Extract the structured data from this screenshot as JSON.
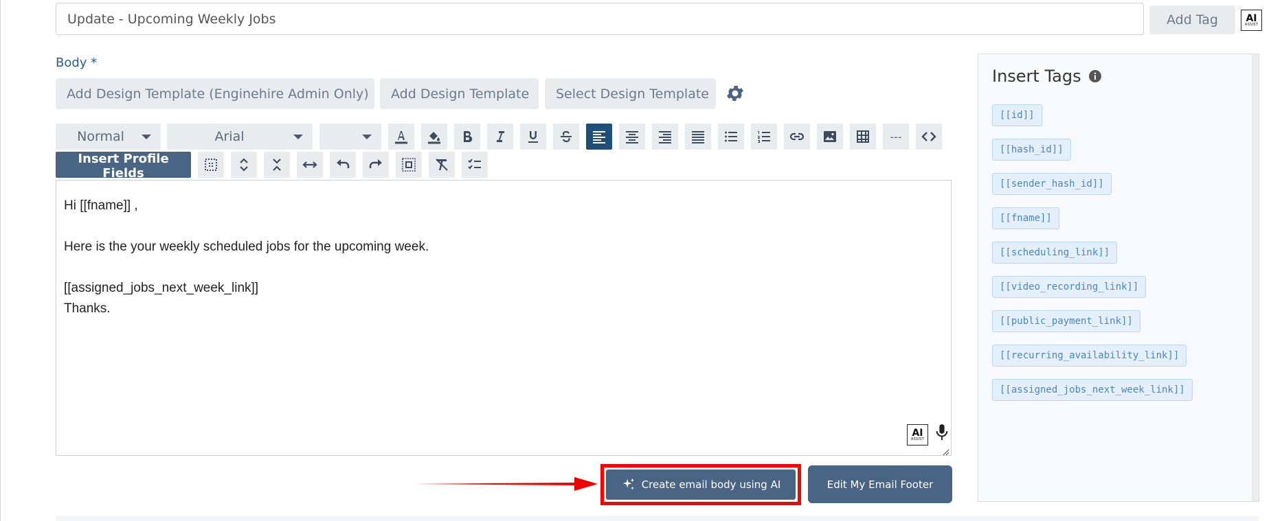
{
  "subject": {
    "value": "Update - Upcoming Weekly Jobs"
  },
  "subject_actions": {
    "add_tag_label": "Add Tag",
    "ai_label": "AI",
    "ai_sub": "ASSIST"
  },
  "body": {
    "label": "Body *",
    "template_buttons": [
      "Add Design Template (Enginehire Admin Only)",
      "Add Design Template",
      "Select Design Template"
    ]
  },
  "toolbar": {
    "format_value": "Normal",
    "font_value": "Arial",
    "size_value": "",
    "hr_label": "---",
    "insert_profile_label": "Insert Profile Fields"
  },
  "editor": {
    "lines": [
      "Hi [[fname]] ,",
      "Here is the your weekly scheduled jobs for the upcoming week.",
      "[[assigned_jobs_next_week_link]]",
      "Thanks."
    ],
    "ai_label": "AI",
    "ai_sub": "ASSIST"
  },
  "actions": {
    "ai_create_label": "Create email body using AI",
    "footer_label": "Edit My Email Footer"
  },
  "tags_panel": {
    "title": "Insert Tags",
    "tags": [
      "[[id]]",
      "[[hash_id]]",
      "[[sender_hash_id]]",
      "[[fname]]",
      "[[scheduling_link]]",
      "[[video_recording_link]]",
      "[[public_payment_link]]",
      "[[recurring_availability_link]]",
      "[[assigned_jobs_next_week_link]]"
    ]
  },
  "colors": {
    "primary": "#4a6584",
    "active_toolbar": "#1f4e79",
    "highlight_border": "#ff0000",
    "tag_text": "#4a86bf",
    "label_blue": "#2a5d8f"
  }
}
